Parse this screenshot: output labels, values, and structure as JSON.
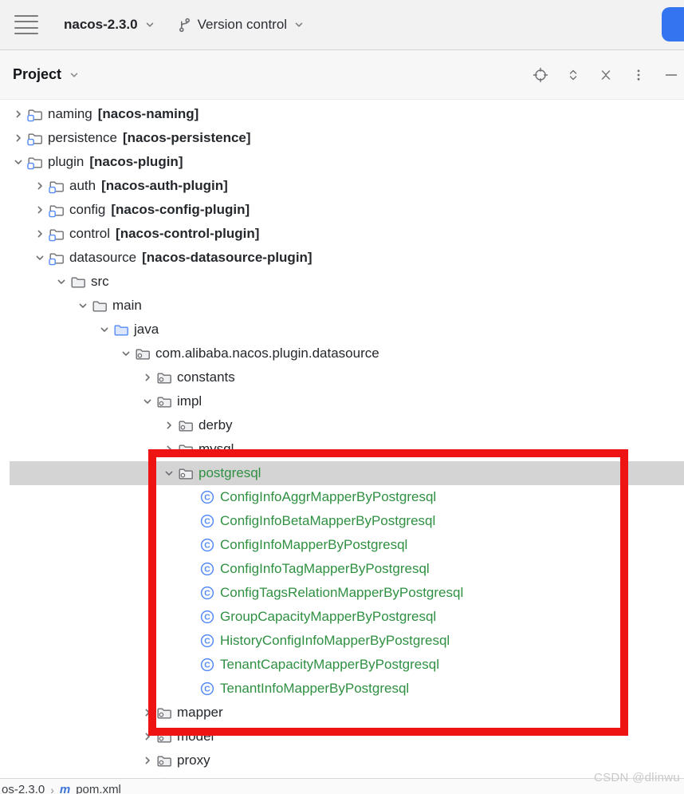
{
  "colors": {
    "accent_blue": "#3574f0",
    "class_icon_blue": "#548af7",
    "vcs_added_green": "#2f9042",
    "selection_gray": "#d4d4d5",
    "annotation_red": "#ee1414"
  },
  "topbar": {
    "project_name": "nacos-2.3.0",
    "version_control_label": "Version control"
  },
  "panel": {
    "title": "Project"
  },
  "tree": {
    "items": [
      {
        "depth": 0,
        "state": "collapsed",
        "icon": "module-folder",
        "label": "naming",
        "suffix": "[nacos-naming]"
      },
      {
        "depth": 0,
        "state": "collapsed",
        "icon": "module-folder",
        "label": "persistence",
        "suffix": "[nacos-persistence]"
      },
      {
        "depth": 0,
        "state": "expanded",
        "icon": "module-folder",
        "label": "plugin",
        "suffix": "[nacos-plugin]"
      },
      {
        "depth": 1,
        "state": "collapsed",
        "icon": "module-folder",
        "label": "auth",
        "suffix": "[nacos-auth-plugin]"
      },
      {
        "depth": 1,
        "state": "collapsed",
        "icon": "module-folder",
        "label": "config",
        "suffix": "[nacos-config-plugin]"
      },
      {
        "depth": 1,
        "state": "collapsed",
        "icon": "module-folder",
        "label": "control",
        "suffix": "[nacos-control-plugin]"
      },
      {
        "depth": 1,
        "state": "expanded",
        "icon": "module-folder",
        "label": "datasource",
        "suffix": "[nacos-datasource-plugin]"
      },
      {
        "depth": 2,
        "state": "expanded",
        "icon": "folder",
        "label": "src"
      },
      {
        "depth": 3,
        "state": "expanded",
        "icon": "folder",
        "label": "main"
      },
      {
        "depth": 4,
        "state": "expanded",
        "icon": "source-folder",
        "label": "java"
      },
      {
        "depth": 5,
        "state": "expanded",
        "icon": "package",
        "label": "com.alibaba.nacos.plugin.datasource"
      },
      {
        "depth": 6,
        "state": "collapsed",
        "icon": "package",
        "label": "constants"
      },
      {
        "depth": 6,
        "state": "expanded",
        "icon": "package",
        "label": "impl"
      },
      {
        "depth": 7,
        "state": "collapsed",
        "icon": "package",
        "label": "derby"
      },
      {
        "depth": 7,
        "state": "collapsed",
        "icon": "package",
        "label": "mysql"
      },
      {
        "depth": 7,
        "state": "expanded",
        "icon": "package",
        "label": "postgresql",
        "green": true,
        "selected": true
      },
      {
        "depth": 8,
        "state": "none",
        "icon": "class",
        "label": "ConfigInfoAggrMapperByPostgresql",
        "green": true
      },
      {
        "depth": 8,
        "state": "none",
        "icon": "class",
        "label": "ConfigInfoBetaMapperByPostgresql",
        "green": true
      },
      {
        "depth": 8,
        "state": "none",
        "icon": "class",
        "label": "ConfigInfoMapperByPostgresql",
        "green": true
      },
      {
        "depth": 8,
        "state": "none",
        "icon": "class",
        "label": "ConfigInfoTagMapperByPostgresql",
        "green": true
      },
      {
        "depth": 8,
        "state": "none",
        "icon": "class",
        "label": "ConfigTagsRelationMapperByPostgresql",
        "green": true
      },
      {
        "depth": 8,
        "state": "none",
        "icon": "class",
        "label": "GroupCapacityMapperByPostgresql",
        "green": true
      },
      {
        "depth": 8,
        "state": "none",
        "icon": "class",
        "label": "HistoryConfigInfoMapperByPostgresql",
        "green": true
      },
      {
        "depth": 8,
        "state": "none",
        "icon": "class",
        "label": "TenantCapacityMapperByPostgresql",
        "green": true
      },
      {
        "depth": 8,
        "state": "none",
        "icon": "class",
        "label": "TenantInfoMapperByPostgresql",
        "green": true
      },
      {
        "depth": 6,
        "state": "collapsed",
        "icon": "package",
        "label": "mapper"
      },
      {
        "depth": 6,
        "state": "collapsed",
        "icon": "package",
        "label": "model"
      },
      {
        "depth": 6,
        "state": "collapsed",
        "icon": "package",
        "label": "proxy"
      },
      {
        "depth": 6,
        "state": "none",
        "icon": "class",
        "label": ""
      }
    ]
  },
  "statusbar": {
    "project_crumb": "os-2.3.0",
    "separator": "›",
    "maven_icon": "m",
    "file_crumb": "pom.xml"
  },
  "watermark": "CSDN @dlinwu"
}
